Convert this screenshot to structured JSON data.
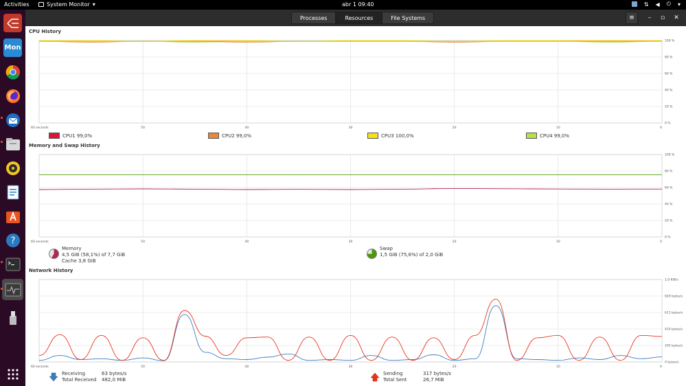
{
  "topbar": {
    "activities": "Activities",
    "app_menu": "System Monitor",
    "clock": "abr 1  09:40"
  },
  "dock": {
    "items": [
      "app-icon",
      "monitor-app-icon",
      "chrome-icon",
      "firefox-icon",
      "thunderbird-icon",
      "files-icon",
      "rhythmbox-icon",
      "writer-icon",
      "software-icon",
      "help-icon",
      "terminal-icon",
      "system-monitor-icon",
      "usb-drive-icon",
      "show-apps-icon"
    ],
    "mon_label": "Mon"
  },
  "header": {
    "tabs": [
      "Processes",
      "Resources",
      "File Systems"
    ],
    "active_tab": "Resources"
  },
  "cpu": {
    "title": "CPU History",
    "y_ticks": [
      "100 %",
      "80 %",
      "60 %",
      "40 %",
      "20 %",
      "0 %"
    ],
    "x_ticks": [
      "60 seconds",
      "50",
      "40",
      "30",
      "20",
      "10",
      "0"
    ],
    "legend": [
      {
        "label": "CPU1",
        "value": "99,0%",
        "color": "#dc143c"
      },
      {
        "label": "CPU2",
        "value": "99,0%",
        "color": "#e8883a"
      },
      {
        "label": "CPU3",
        "value": "100,0%",
        "color": "#f5e11a"
      },
      {
        "label": "CPU4",
        "value": "99,0%",
        "color": "#b7e04c"
      }
    ]
  },
  "memory": {
    "title": "Memory and Swap History",
    "y_ticks": [
      "100 %",
      "80 %",
      "60 %",
      "40 %",
      "20 %",
      "0 %"
    ],
    "x_ticks": [
      "60 seconds",
      "50",
      "40",
      "30",
      "20",
      "10",
      "0"
    ],
    "memory_label": "Memory",
    "memory_value": "4,5 GiB (58,1%) of 7,7 GiB",
    "cache_value": "Cache 3,8 GiB",
    "memory_percent": 58.1,
    "memory_color": "#b5245a",
    "swap_label": "Swap",
    "swap_value": "1,5 GiB (75,6%) of 2,0 GiB",
    "swap_percent": 75.6,
    "swap_color": "#4e9a06"
  },
  "network": {
    "title": "Network History",
    "y_ticks": [
      "1,0 KiB/s",
      "820 bytes/s",
      "611 bytes/s",
      "410 bytes/s",
      "205 bytes/s",
      "0 bytes/s"
    ],
    "x_ticks": [
      "60 seconds",
      "50",
      "40",
      "30",
      "20",
      "10",
      "0"
    ],
    "receiving_label": "Receiving",
    "receiving_value": "63 bytes/s",
    "total_received_label": "Total Received",
    "total_received_value": "482,0 MiB",
    "receiving_color": "#3b7cbf",
    "sending_label": "Sending",
    "sending_value": "317 bytes/s",
    "total_sent_label": "Total Sent",
    "total_sent_value": "26,7 MiB",
    "sending_color": "#e8341c"
  },
  "chart_data": [
    {
      "type": "line",
      "title": "CPU History",
      "x": [
        60,
        55,
        50,
        45,
        40,
        35,
        30,
        25,
        20,
        15,
        10,
        5,
        0
      ],
      "ylim": [
        0,
        100
      ],
      "series": [
        {
          "name": "CPU1",
          "values": [
            99,
            99,
            99,
            99,
            99,
            99,
            99,
            99,
            99,
            99,
            99,
            99,
            99
          ]
        },
        {
          "name": "CPU2",
          "values": [
            99,
            98,
            99,
            99,
            98,
            99,
            99,
            99,
            98,
            99,
            99,
            99,
            99
          ]
        },
        {
          "name": "CPU3",
          "values": [
            100,
            100,
            99,
            100,
            100,
            99,
            100,
            100,
            99,
            100,
            100,
            100,
            100
          ]
        },
        {
          "name": "CPU4",
          "values": [
            99,
            99,
            99,
            98,
            99,
            99,
            99,
            99,
            99,
            99,
            99,
            98,
            99
          ]
        }
      ]
    },
    {
      "type": "line",
      "title": "Memory and Swap History",
      "x": [
        60,
        55,
        50,
        45,
        40,
        35,
        30,
        25,
        20,
        15,
        10,
        5,
        0
      ],
      "ylim": [
        0,
        100
      ],
      "series": [
        {
          "name": "Memory",
          "values": [
            57.5,
            58,
            58.3,
            58,
            57.5,
            57.8,
            57.5,
            58,
            58.8,
            58.5,
            58.2,
            58,
            58.1
          ]
        },
        {
          "name": "Swap",
          "values": [
            75.6,
            75.6,
            75.6,
            75.6,
            75.6,
            75.6,
            75.6,
            75.6,
            75.6,
            75.6,
            75.6,
            75.6,
            75.6
          ]
        }
      ]
    },
    {
      "type": "line",
      "title": "Network History",
      "x": [
        60,
        58,
        56,
        54,
        52,
        50,
        48,
        46,
        44,
        42,
        40,
        38,
        36,
        34,
        32,
        30,
        28,
        26,
        24,
        22,
        20,
        18,
        16,
        14,
        12,
        10,
        8,
        6,
        4,
        2,
        0
      ],
      "ylim": [
        0,
        1024
      ],
      "series": [
        {
          "name": "Receiving",
          "values": [
            20,
            80,
            30,
            40,
            20,
            50,
            15,
            590,
            120,
            40,
            30,
            60,
            100,
            20,
            30,
            20,
            80,
            20,
            30,
            90,
            20,
            40,
            700,
            40,
            30,
            20,
            50,
            30,
            80,
            40,
            63
          ]
        },
        {
          "name": "Sending",
          "values": [
            80,
            340,
            30,
            330,
            20,
            300,
            20,
            640,
            320,
            80,
            300,
            310,
            20,
            310,
            20,
            330,
            20,
            310,
            20,
            300,
            30,
            330,
            780,
            20,
            300,
            330,
            20,
            310,
            20,
            330,
            317
          ]
        }
      ]
    }
  ]
}
